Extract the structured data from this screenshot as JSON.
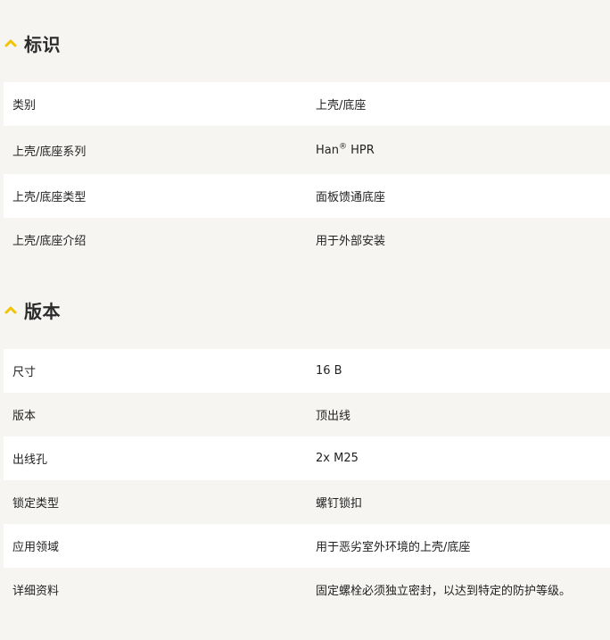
{
  "accent_color": "#f2c300",
  "sections": [
    {
      "title": "标识",
      "icon": "chevron-up-icon",
      "rows": [
        {
          "label": "类别",
          "value": "上壳/底座"
        },
        {
          "label": "上壳/底座系列",
          "value_main": "Han",
          "value_sup": "®",
          "value_tail": " HPR"
        },
        {
          "label": "上壳/底座类型",
          "value": "面板馈通底座"
        },
        {
          "label": "上壳/底座介绍",
          "value": "用于外部安装"
        }
      ]
    },
    {
      "title": "版本",
      "icon": "chevron-up-icon",
      "rows": [
        {
          "label": "尺寸",
          "value": "16 B"
        },
        {
          "label": "版本",
          "value": "顶出线"
        },
        {
          "label": "出线孔",
          "value": "2x M25"
        },
        {
          "label": "锁定类型",
          "value": "螺钉锁扣"
        },
        {
          "label": "应用领域",
          "value": "用于恶劣室外环境的上壳/底座"
        },
        {
          "label": "详细资料",
          "value": "固定螺栓必须独立密封，以达到特定的防护等级。"
        }
      ]
    }
  ]
}
